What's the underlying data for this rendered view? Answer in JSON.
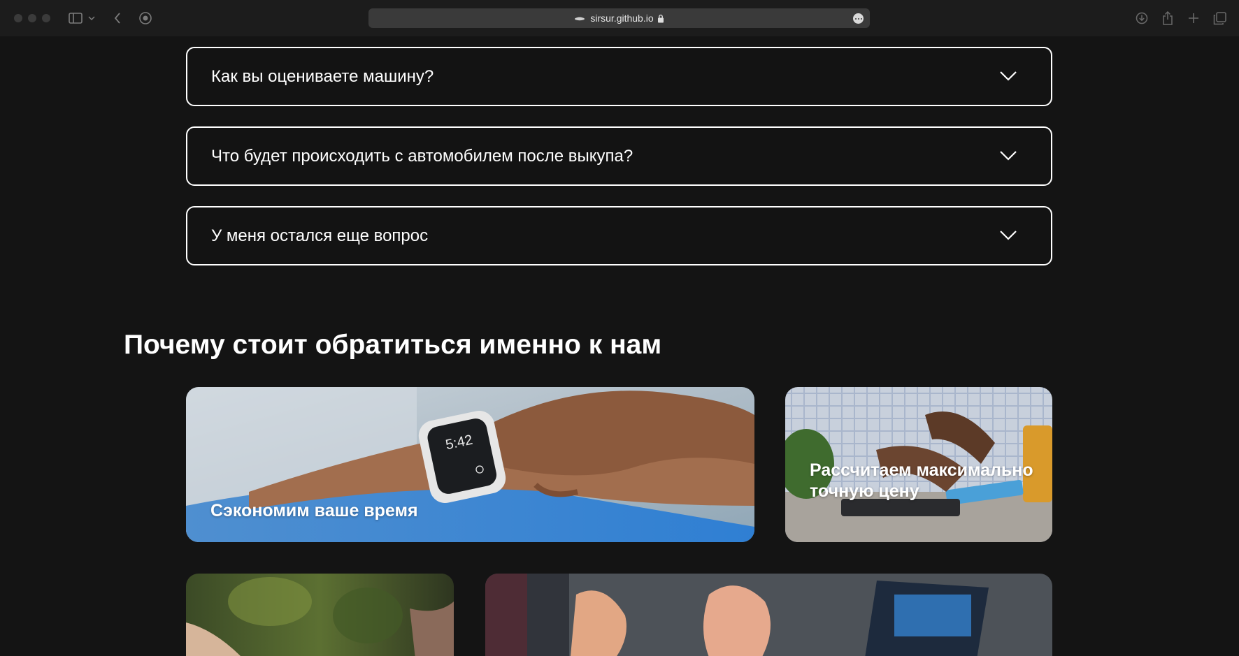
{
  "browser": {
    "url": "sirsur.github.io",
    "icons": [
      "sidebar-icon",
      "chevron-down-icon",
      "back-icon",
      "privacy-report-icon",
      "private-mode-icon",
      "lock-icon",
      "more-icon",
      "download-icon",
      "share-icon",
      "new-tab-icon",
      "tab-overview-icon"
    ]
  },
  "faq": {
    "items": [
      {
        "question": "Как вы оцениваете машину?"
      },
      {
        "question": "Что будет происходить с автомобилем после выкупа?"
      },
      {
        "question": "У меня остался еще вопрос"
      }
    ]
  },
  "why_us": {
    "title": "Почему стоит обратиться именно к нам",
    "cards": [
      {
        "label": "Сэкономим ваше время",
        "image": "hand-with-smartwatch-photo"
      },
      {
        "label": "Рассчитаем максимально точную цену",
        "image": "calculator-typing-photo"
      },
      {
        "label": "",
        "image": "outdoor-handshake-photo"
      },
      {
        "label": "",
        "image": "meeting-laptop-photo"
      }
    ]
  },
  "colors": {
    "background": "#141414",
    "text": "#ffffff",
    "address_bar": "#3a3a3a"
  }
}
